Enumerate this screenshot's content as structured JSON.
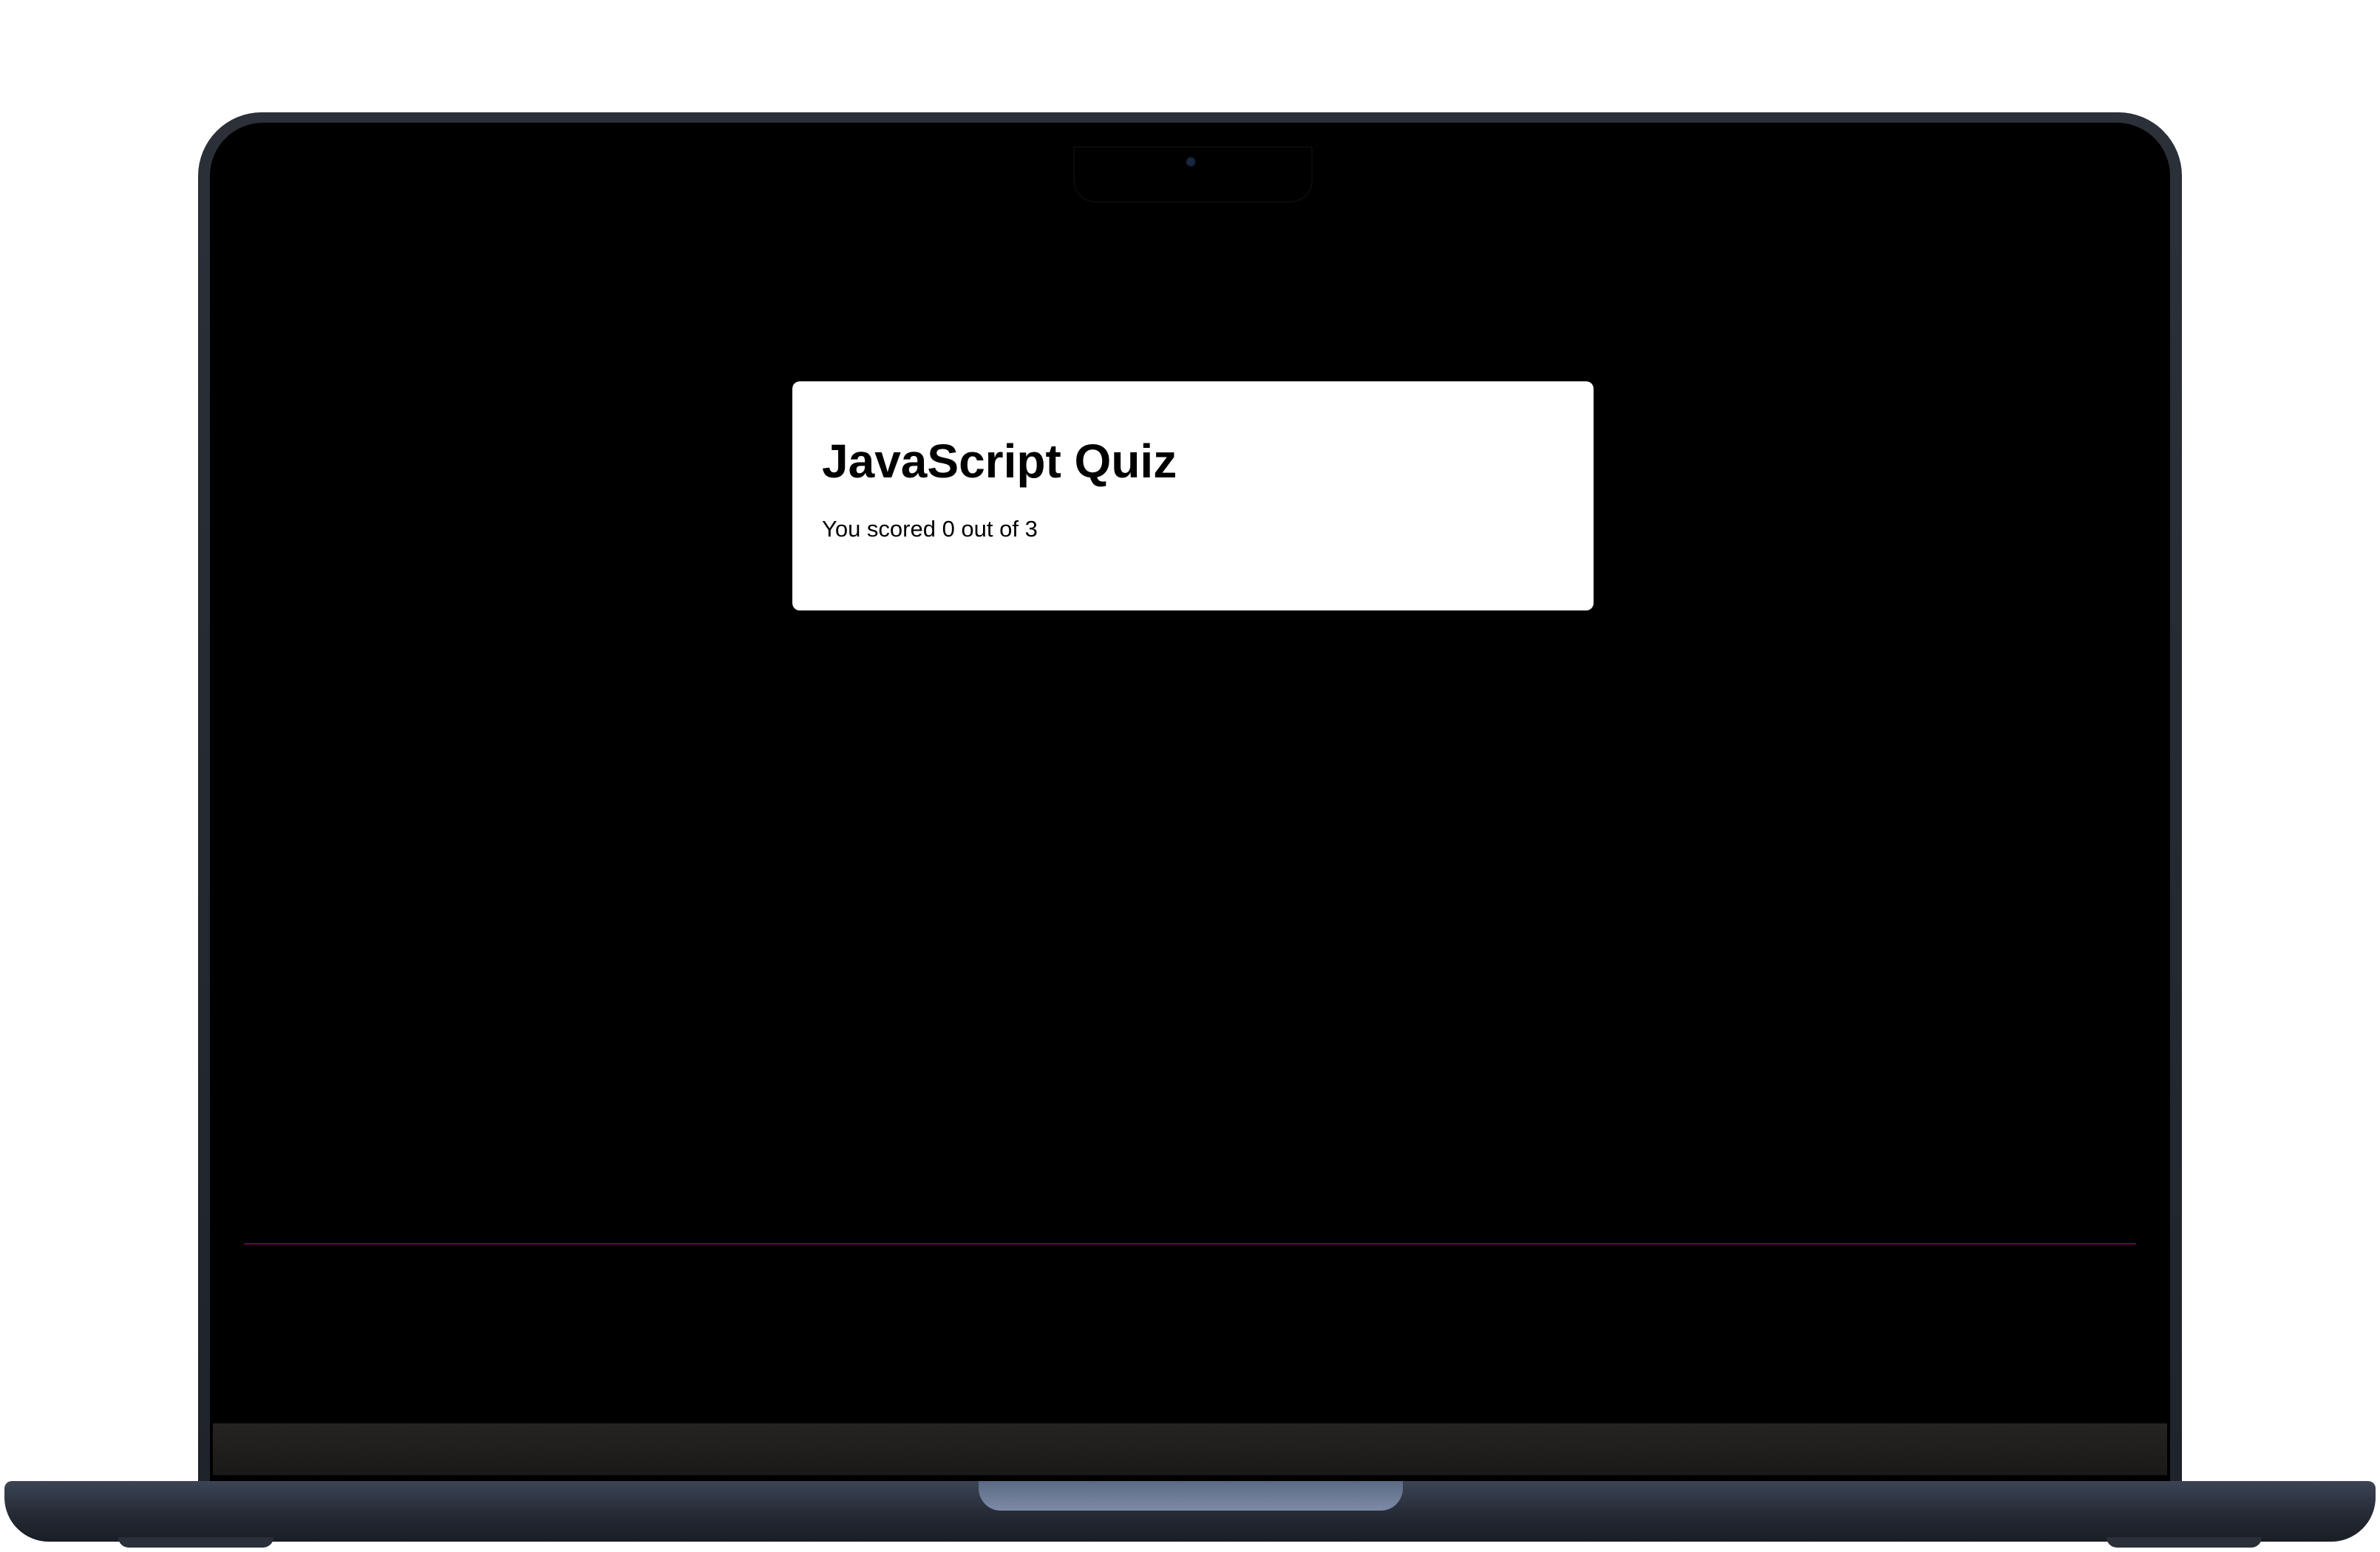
{
  "quiz": {
    "title": "JavaScript Quiz",
    "score_text": "You scored 0 out of 3"
  },
  "theme": {
    "screen_background": "#000000",
    "card_background": "#ffffff",
    "text_color": "#000000",
    "accent_line": "#5a0b4e"
  }
}
